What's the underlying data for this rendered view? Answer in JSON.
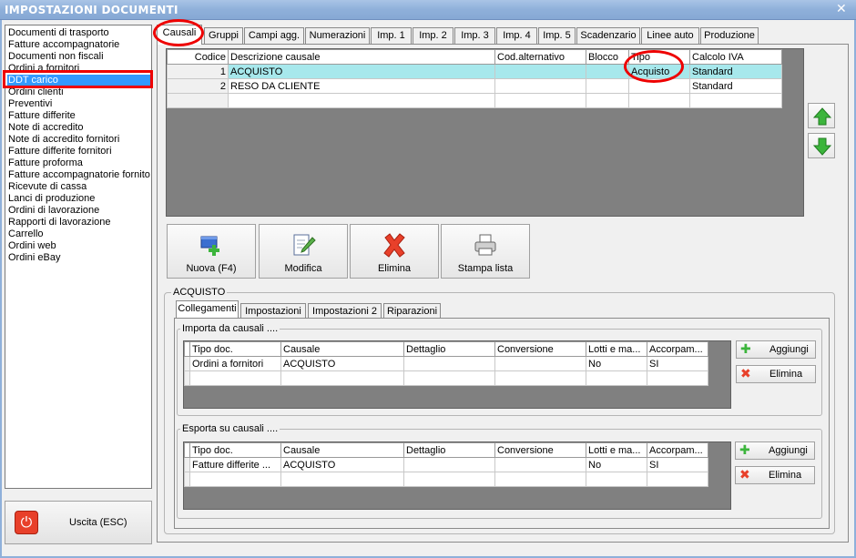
{
  "window": {
    "title": "IMPOSTAZIONI DOCUMENTI"
  },
  "doc_list": [
    "Documenti di trasporto",
    "Fatture accompagnatorie",
    "Documenti non fiscali",
    "Ordini a fornitori",
    "DDT carico",
    "Ordini clienti",
    "Preventivi",
    "Fatture differite",
    "Note di accredito",
    "Note di accredito fornitori",
    "Fatture differite fornitori",
    "Fatture proforma",
    "Fatture accompagnatorie fornito",
    "Ricevute di cassa",
    "Lanci di produzione",
    "Ordini di lavorazione",
    "Rapporti di lavorazione",
    "Carrello",
    "Ordini web",
    "Ordini eBay"
  ],
  "selected_doc": "DDT carico",
  "exit_button": "Uscita (ESC)",
  "tabs": [
    "Causali",
    "Gruppi",
    "Campi agg.",
    "Numerazioni",
    "Imp. 1",
    "Imp. 2",
    "Imp. 3",
    "Imp. 4",
    "Imp. 5",
    "Scadenzario",
    "Linee auto",
    "Produzione"
  ],
  "causali_grid": {
    "columns": [
      "Codice",
      "Descrizione causale",
      "Cod.alternativo",
      "Blocco",
      "Tipo",
      "Calcolo IVA"
    ],
    "rows": [
      {
        "codice": "1",
        "descrizione": "ACQUISTO",
        "cod_alt": "",
        "blocco": "",
        "tipo": "Acquisto",
        "calcolo_iva": "Standard"
      },
      {
        "codice": "2",
        "descrizione": "RESO DA CLIENTE",
        "cod_alt": "",
        "blocco": "",
        "tipo": "",
        "calcolo_iva": "Standard"
      }
    ]
  },
  "actions": {
    "new": "Nuova (F4)",
    "edit": "Modifica",
    "delete": "Elimina",
    "print": "Stampa lista"
  },
  "detail": {
    "group_title": "ACQUISTO",
    "subtabs": [
      "Collegamenti",
      "Impostazioni",
      "Impostazioni 2",
      "Riparazioni"
    ],
    "import_section": {
      "title": "Importa da causali ....",
      "columns": [
        "Tipo doc.",
        "Causale",
        "Dettaglio",
        "Conversione",
        "Lotti e ma...",
        "Accorpam..."
      ],
      "rows": [
        {
          "tipo_doc": "Ordini a fornitori",
          "causale": "ACQUISTO",
          "dettaglio": "",
          "conversione": "",
          "lotti": "No",
          "accorpam": "SI"
        }
      ],
      "add": "Aggiungi",
      "delete": "Elimina"
    },
    "export_section": {
      "title": "Esporta su causali ....",
      "columns": [
        "Tipo doc.",
        "Causale",
        "Dettaglio",
        "Conversione",
        "Lotti e ma...",
        "Accorpam..."
      ],
      "rows": [
        {
          "tipo_doc": "Fatture differite ...",
          "causale": "ACQUISTO",
          "dettaglio": "",
          "conversione": "",
          "lotti": "No",
          "accorpam": "SI"
        }
      ],
      "add": "Aggiungi",
      "delete": "Elimina"
    }
  }
}
